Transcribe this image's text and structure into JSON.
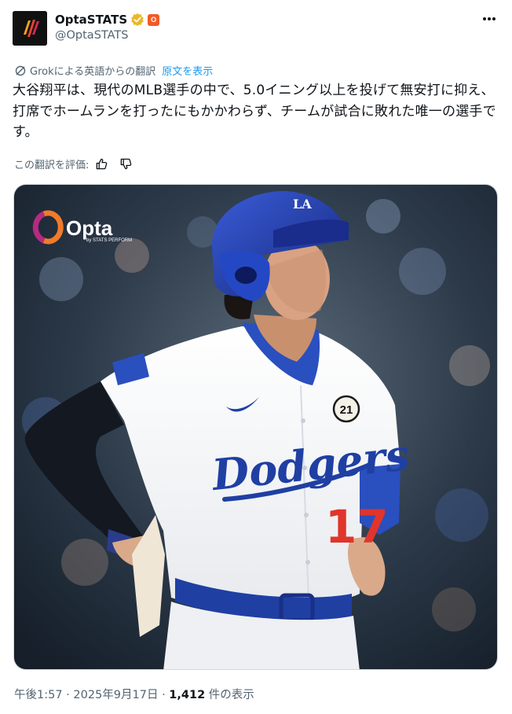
{
  "account": {
    "display_name": "OptaSTATS",
    "handle": "@OptaSTATS",
    "affiliate_badge_text": "O"
  },
  "translation": {
    "label": "Grokによる英語からの翻訳",
    "show_original": "原文を表示",
    "rate_label": "この翻訳を評価:"
  },
  "tweet": {
    "text": " 大谷翔平は、現代のMLB選手の中で、5.0イニング以上を投げて無安打に抑え、打席でホームランを打ったにもかかわらず、チームが試合に敗れた唯一の選手です。"
  },
  "media": {
    "logo_text": "Opta",
    "logo_sub": "by STATS PERFORM",
    "jersey_text": "Dodgers",
    "jersey_number": "17",
    "patch_number": "21",
    "helmet_logo": "LA"
  },
  "meta": {
    "time": "午後1:57",
    "sep": " · ",
    "date": "2025年9月17日",
    "views": "1,412",
    "views_label": " 件の表示"
  },
  "colors": {
    "text": "#0f1419",
    "secondary": "#536471",
    "link": "#1d9bf0",
    "verified": "#e8b829",
    "dodger_blue": "#1f3fa3",
    "jersey_red": "#e0352b"
  }
}
